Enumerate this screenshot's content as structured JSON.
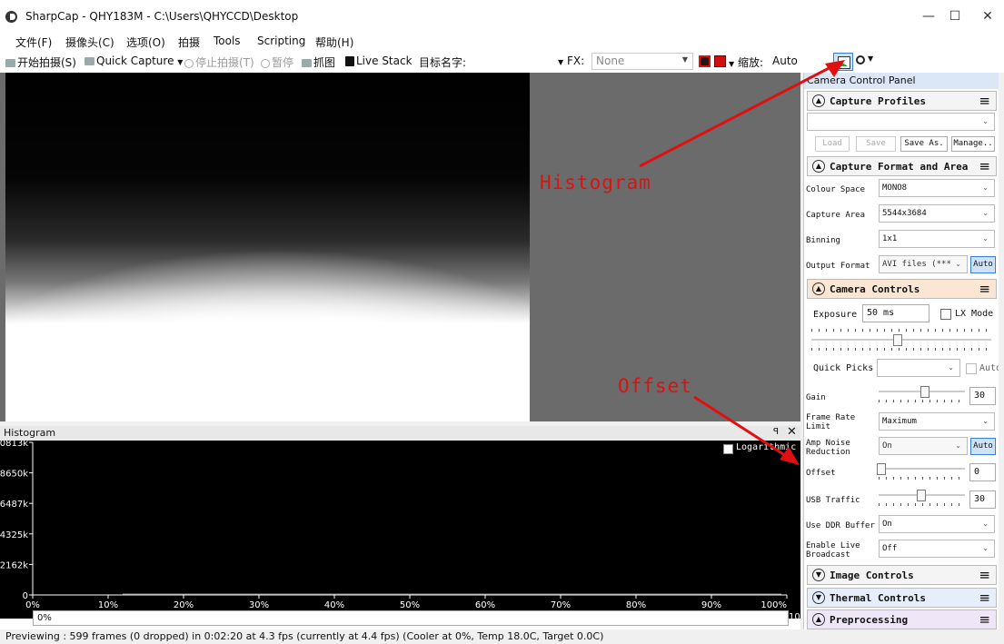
{
  "window": {
    "title": "SharpCap - QHY183M - C:\\Users\\QHYCCD\\Desktop",
    "minimize": "—",
    "maximize": "☐",
    "close": "✕"
  },
  "menu": [
    "文件(F)",
    "摄像头(C)",
    "选项(O)",
    "拍摄",
    "Tools",
    "Scripting",
    "帮助(H)"
  ],
  "toolbar": {
    "start_capture": "开始拍摄(S)",
    "quick_capture": "Quick Capture",
    "stop_capture": "停止拍摄(T)",
    "pause": "暂停",
    "snapshot": "抓图",
    "live_stack": "Live Stack",
    "target_label": "目标名字:",
    "target_value": "",
    "fx_label": "FX:",
    "fx_value": "None",
    "zoom_label": "缩放:",
    "zoom_value": "Auto",
    "colors": {
      "stop_red": "#e01010",
      "box_red": "#d01010"
    }
  },
  "annotations": {
    "histogram": "Histogram",
    "offset": "Offset",
    "color": "#e01010"
  },
  "histogram": {
    "title": "Histogram",
    "pin": "ꟼ",
    "close": "✕",
    "logarithmic_label": "Logarithmic",
    "current_value": "0%",
    "end_value": "10",
    "y_ticks": [
      "0813k",
      "8650k",
      "6487k",
      "4325k",
      "2162k",
      "0"
    ],
    "x_ticks": [
      "0%",
      "10%",
      "20%",
      "30%",
      "40%",
      "50%",
      "60%",
      "70%",
      "80%",
      "90%",
      "100%"
    ]
  },
  "status": {
    "text": "Previewing : 599 frames (0 dropped) in 0:02:20 at 4.3 fps  (currently at 4.4 fps) (Cooler at 0%, Temp 18.0C, Target 0.0C)"
  },
  "panel": {
    "title": "Camera Control Panel",
    "capture_profiles": {
      "title": "Capture Profiles",
      "profile_value": "",
      "load": "Load",
      "save": "Save",
      "save_as": "Save As.",
      "manage": "Manage.."
    },
    "format": {
      "title": "Capture Format and Area",
      "colour_space_label": "Colour Space",
      "colour_space_value": "MONO8",
      "capture_area_label": "Capture Area",
      "capture_area_value": "5544x3684",
      "binning_label": "Binning",
      "binning_value": "1x1",
      "output_format_label": "Output Format",
      "output_format_value": "AVI files (***",
      "auto": "Auto"
    },
    "camera": {
      "title": "Camera Controls",
      "exposure_label": "Exposure",
      "exposure_value": "50 ms",
      "lx_mode_label": "LX Mode",
      "quick_picks_label": "Quick Picks",
      "quick_picks_value": "",
      "auto": "Auto",
      "gain_label": "Gain",
      "gain_value": "30",
      "frame_rate_label_1": "Frame Rate",
      "frame_rate_label_2": "Limit",
      "frame_rate_value": "Maximum",
      "amp_noise_label_1": "Amp Noise",
      "amp_noise_label_2": "Reduction",
      "amp_noise_value": "On",
      "amp_auto": "Auto",
      "offset_label": "Offset",
      "offset_value": "0",
      "usb_label": "USB Traffic",
      "usb_value": "30",
      "ddr_label": "Use DDR Buffer",
      "ddr_value": "On",
      "broadcast_label_1": "Enable Live",
      "broadcast_label_2": "Broadcast",
      "broadcast_value": "Off"
    },
    "image_controls": "Image Controls",
    "thermal_controls": "Thermal Controls",
    "preprocessing": "Preprocessing",
    "menu_glyph": "≡",
    "chevron_up": "▲",
    "chevron_down": "▼",
    "dropdown_arrow": "⌄"
  }
}
